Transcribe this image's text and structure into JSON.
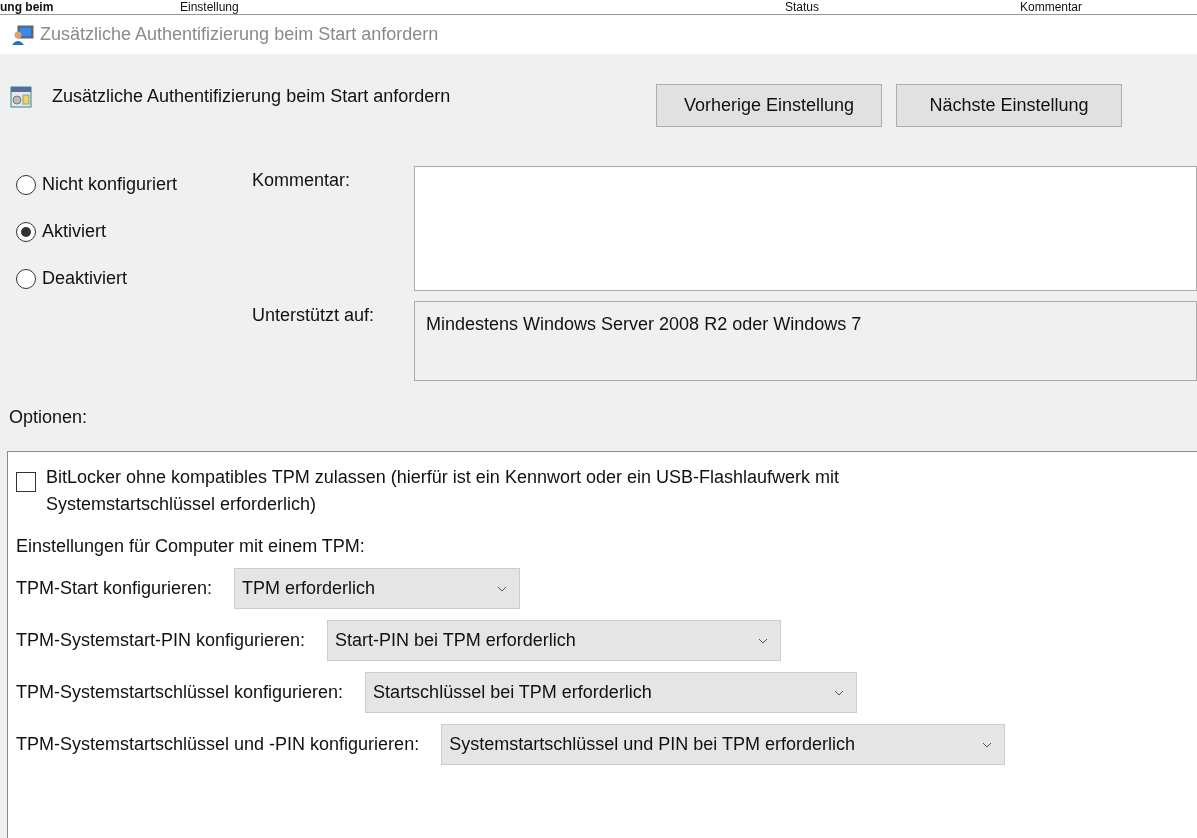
{
  "background_header": {
    "columns": [
      {
        "label": "ung beim",
        "bold": true
      },
      {
        "label": "Einstellung",
        "bold": false
      },
      {
        "label": "Status",
        "bold": false
      },
      {
        "label": "Kommentar",
        "bold": false
      }
    ]
  },
  "window": {
    "title": "Zusätzliche Authentifizierung beim Start anfordern"
  },
  "setting": {
    "title": "Zusätzliche Authentifizierung beim Start anfordern"
  },
  "buttons": [
    {
      "label": "Vorherige Einstellung"
    },
    {
      "label": "Nächste Einstellung"
    }
  ],
  "state_options": [
    {
      "label": "Nicht konfiguriert",
      "selected": false
    },
    {
      "label": "Aktiviert",
      "selected": true
    },
    {
      "label": "Deaktiviert",
      "selected": false
    }
  ],
  "comment": {
    "label": "Kommentar:"
  },
  "supported_on": {
    "label": "Unterstützt auf:",
    "value": "Mindestens Windows Server 2008 R2 oder Windows 7"
  },
  "options": {
    "label": "Optionen:",
    "checkbox": {
      "label": "BitLocker ohne kompatibles TPM zulassen (hierfür ist ein Kennwort oder ein USB-Flashlaufwerk mit Systemstartschlüssel erforderlich)",
      "checked": false
    },
    "section_label": "Einstellungen für Computer mit einem TPM:",
    "dropdowns": [
      {
        "label": "TPM-Start konfigurieren:",
        "value": "TPM erforderlich"
      },
      {
        "label": "TPM-Systemstart-PIN konfigurieren:",
        "value": "Start-PIN bei TPM erforderlich"
      },
      {
        "label": "TPM-Systemstartschlüssel konfigurieren:",
        "value": "Startschlüssel bei TPM erforderlich"
      },
      {
        "label": "TPM-Systemstartschlüssel und -PIN konfigurieren:",
        "value": "Systemstartschlüssel und PIN bei TPM erforderlich"
      }
    ]
  }
}
